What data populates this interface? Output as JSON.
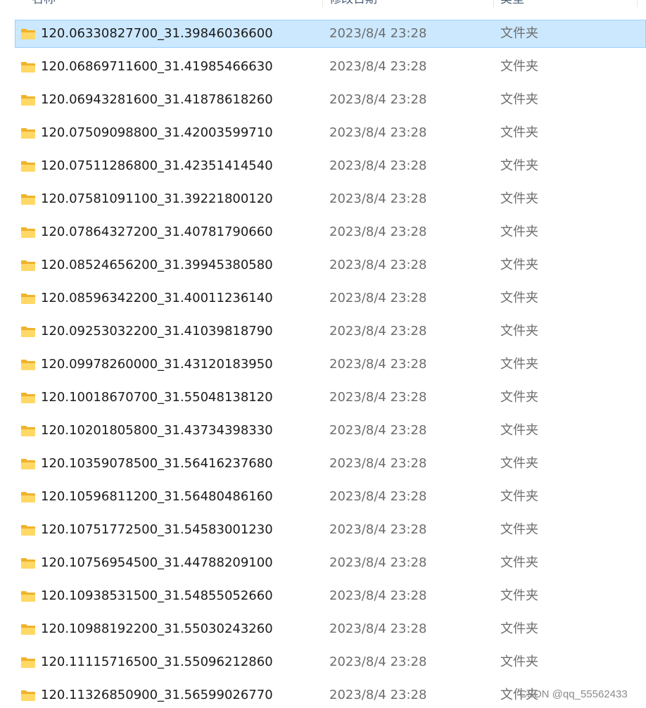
{
  "header": {
    "name_label": "名称",
    "date_label": "修改日期",
    "type_label": "类型"
  },
  "files": [
    {
      "name": "120.06330827700_31.39846036600",
      "date": "2023/8/4 23:28",
      "type": "文件夹",
      "selected": true
    },
    {
      "name": "120.06869711600_31.41985466630",
      "date": "2023/8/4 23:28",
      "type": "文件夹"
    },
    {
      "name": "120.06943281600_31.41878618260",
      "date": "2023/8/4 23:28",
      "type": "文件夹"
    },
    {
      "name": "120.07509098800_31.42003599710",
      "date": "2023/8/4 23:28",
      "type": "文件夹"
    },
    {
      "name": "120.07511286800_31.42351414540",
      "date": "2023/8/4 23:28",
      "type": "文件夹"
    },
    {
      "name": "120.07581091100_31.39221800120",
      "date": "2023/8/4 23:28",
      "type": "文件夹"
    },
    {
      "name": "120.07864327200_31.40781790660",
      "date": "2023/8/4 23:28",
      "type": "文件夹"
    },
    {
      "name": "120.08524656200_31.39945380580",
      "date": "2023/8/4 23:28",
      "type": "文件夹"
    },
    {
      "name": "120.08596342200_31.40011236140",
      "date": "2023/8/4 23:28",
      "type": "文件夹"
    },
    {
      "name": "120.09253032200_31.41039818790",
      "date": "2023/8/4 23:28",
      "type": "文件夹"
    },
    {
      "name": "120.09978260000_31.43120183950",
      "date": "2023/8/4 23:28",
      "type": "文件夹"
    },
    {
      "name": "120.10018670700_31.55048138120",
      "date": "2023/8/4 23:28",
      "type": "文件夹"
    },
    {
      "name": "120.10201805800_31.43734398330",
      "date": "2023/8/4 23:28",
      "type": "文件夹"
    },
    {
      "name": "120.10359078500_31.56416237680",
      "date": "2023/8/4 23:28",
      "type": "文件夹"
    },
    {
      "name": "120.10596811200_31.56480486160",
      "date": "2023/8/4 23:28",
      "type": "文件夹"
    },
    {
      "name": "120.10751772500_31.54583001230",
      "date": "2023/8/4 23:28",
      "type": "文件夹"
    },
    {
      "name": "120.10756954500_31.44788209100",
      "date": "2023/8/4 23:28",
      "type": "文件夹"
    },
    {
      "name": "120.10938531500_31.54855052660",
      "date": "2023/8/4 23:28",
      "type": "文件夹"
    },
    {
      "name": "120.10988192200_31.55030243260",
      "date": "2023/8/4 23:28",
      "type": "文件夹"
    },
    {
      "name": "120.11115716500_31.55096212860",
      "date": "2023/8/4 23:28",
      "type": "文件夹"
    },
    {
      "name": "120.11326850900_31.56599026770",
      "date": "2023/8/4 23:28",
      "type": "文件夹"
    }
  ],
  "watermark": "CSDN @qq_55562433",
  "colors": {
    "selection_bg": "#cce8ff",
    "selection_border": "#99d1ff",
    "folder_yellow": "#ffd866",
    "folder_tab": "#f0b429"
  },
  "icons": {
    "folder": "folder-icon"
  }
}
